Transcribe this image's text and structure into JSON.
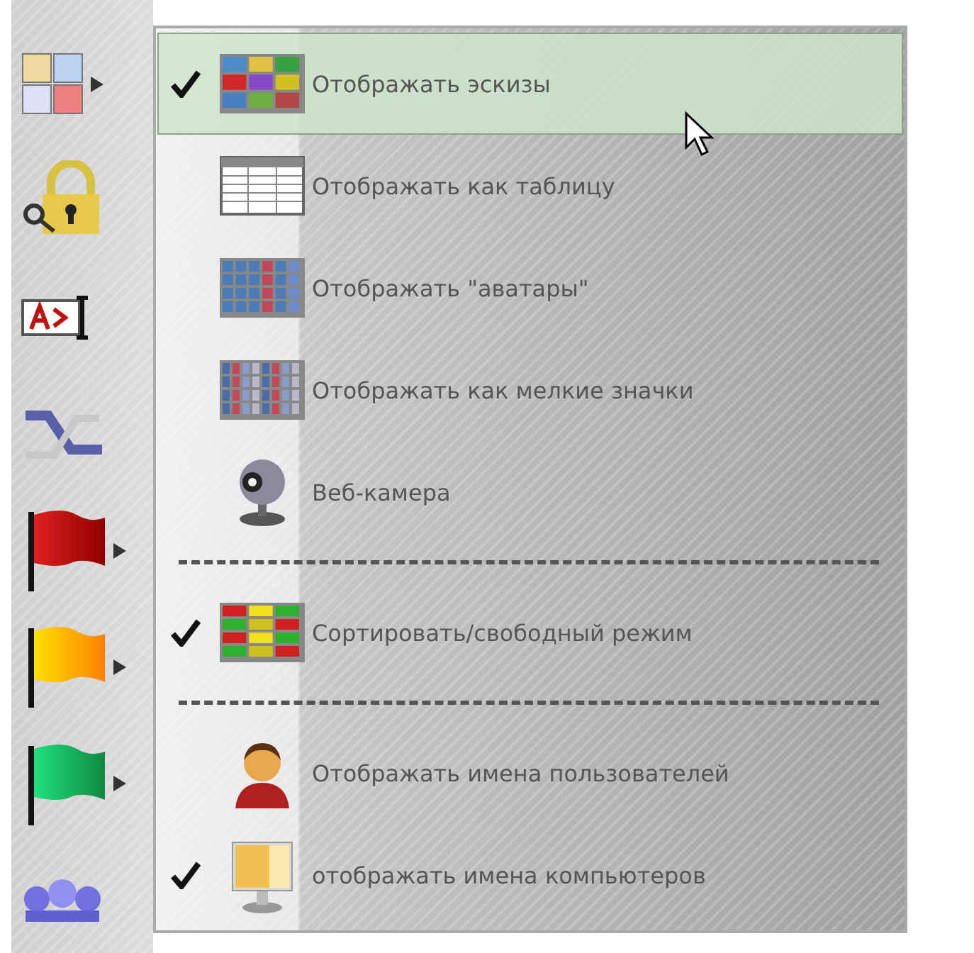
{
  "toolbar": {
    "items": [
      {
        "kind": "tiles",
        "submenu": true
      },
      {
        "kind": "lock",
        "submenu": false
      },
      {
        "kind": "rename",
        "submenu": false
      },
      {
        "kind": "route",
        "submenu": false
      },
      {
        "kind": "flag-red",
        "submenu": true
      },
      {
        "kind": "flag-yellow",
        "submenu": true
      },
      {
        "kind": "flag-green",
        "submenu": true
      },
      {
        "kind": "users",
        "submenu": false
      }
    ]
  },
  "menu": {
    "entries": [
      {
        "kind": "thumbs",
        "label": "Отображать эскизы",
        "checked": true,
        "selected": true
      },
      {
        "kind": "table",
        "label": "Отображать как таблицу",
        "checked": false,
        "selected": false
      },
      {
        "kind": "avatars",
        "label": "Отображать \"аватары\"",
        "checked": false,
        "selected": false
      },
      {
        "kind": "small",
        "label": "Отображать как мелкие значки",
        "checked": false,
        "selected": false
      },
      {
        "kind": "webcam",
        "label": "Веб-камера",
        "checked": false,
        "selected": false
      },
      {
        "kind": "separator"
      },
      {
        "kind": "sort",
        "label": "Сортировать/свободный режим",
        "checked": true,
        "selected": false
      },
      {
        "kind": "separator"
      },
      {
        "kind": "user",
        "label": "Отображать имена пользователей",
        "checked": false,
        "selected": false
      },
      {
        "kind": "monitor",
        "label": "отображать имена компьютеров",
        "checked": true,
        "selected": false
      }
    ]
  }
}
